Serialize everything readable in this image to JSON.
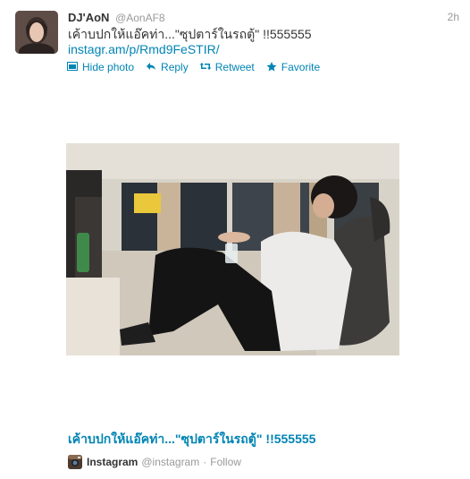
{
  "tweet": {
    "fullname": "DJ'AoN",
    "username": "@AonAF8",
    "time": "2h",
    "text": "เค้าบปกให้แอ๊คท่า...\"ซุปตาร์ในรถตู้\" !!555555",
    "link": "instagr.am/p/Rmd9FeSTIR/"
  },
  "actions": [
    {
      "label": "Hide photo",
      "icon": "photo-icon"
    },
    {
      "label": "Reply",
      "icon": "reply-icon"
    },
    {
      "label": "Retweet",
      "icon": "retweet-icon"
    },
    {
      "label": "Favorite",
      "icon": "star-icon"
    }
  ],
  "card": {
    "title": "เค้าบปกให้แอ๊คท่า...\"ซุปตาร์ในรถตู้\" !!555555",
    "source_name": "Instagram",
    "source_handle": "@instagram",
    "separator": "·",
    "follow_label": "Follow"
  },
  "colors": {
    "link": "#0084b4",
    "muted": "#999999",
    "text": "#333333",
    "instagram": "#3f729b"
  }
}
